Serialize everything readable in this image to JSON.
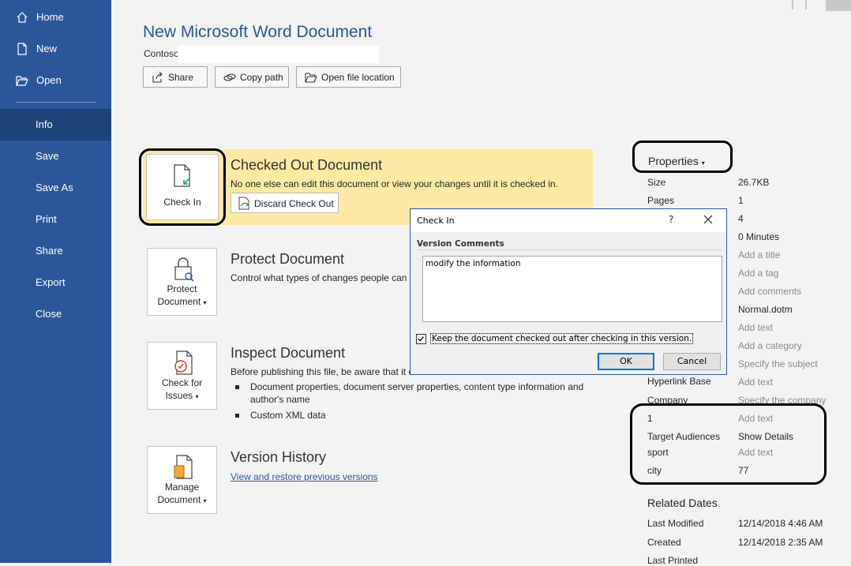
{
  "sidebar": {
    "items": [
      {
        "label": "Home",
        "icon": "home-icon"
      },
      {
        "label": "New",
        "icon": "new-doc-icon"
      },
      {
        "label": "Open",
        "icon": "folder-open-icon"
      },
      {
        "label": "Info"
      },
      {
        "label": "Save"
      },
      {
        "label": "Save As"
      },
      {
        "label": "Print"
      },
      {
        "label": "Share"
      },
      {
        "label": "Export"
      },
      {
        "label": "Close"
      }
    ],
    "active": "Info"
  },
  "header": {
    "title": "New Microsoft Word Document",
    "path": "Contoso",
    "buttons": {
      "share": "Share",
      "copy_path": "Copy path",
      "open_location": "Open file location"
    }
  },
  "sections": {
    "checkout": {
      "button_label": "Check In",
      "title": "Checked Out Document",
      "description": "No one else can edit this document or view your changes until it is checked in.",
      "discard_label": "Discard Check Out"
    },
    "protect": {
      "button_line1": "Protect",
      "button_line2": "Document",
      "title": "Protect Document",
      "description": "Control what types of changes people can m"
    },
    "inspect": {
      "button_line1": "Check for",
      "button_line2": "Issues",
      "title": "Inspect Document",
      "description": "Before publishing this file, be aware that it c",
      "bullets": [
        "Document properties, document server properties, content type information and author's name",
        "Custom XML data"
      ]
    },
    "version": {
      "button_line1": "Manage",
      "button_line2": "Document",
      "title": "Version History",
      "link": "View and restore previous versions"
    }
  },
  "properties": {
    "title": "Properties",
    "size_label": "Size",
    "size_value": "26.7KB",
    "pages_label": "Pages",
    "pages_value": "1",
    "words_value": "4",
    "time_value": "0 Minutes",
    "add_title": "Add a title",
    "add_tag": "Add a tag",
    "add_comments": "Add comments",
    "template_value": "Normal.dotm",
    "add_text_1": "Add text",
    "add_category": "Add a category",
    "specify_subject": "Specify the subject",
    "hyperlink_label": "Hyperlink Base",
    "hyperlink_value": "Add text",
    "company_label": "Company",
    "company_value": "Specify the company",
    "custom_1_label": "1",
    "custom_1_value": "Add text",
    "target_label": "Target Audiences",
    "target_value": "Show Details",
    "sport_label": "sport",
    "sport_value": "Add text",
    "city_label": "city",
    "city_value": "77"
  },
  "related_dates": {
    "title": "Related Dates",
    "last_modified_label": "Last Modified",
    "last_modified_value": "12/14/2018 4:46 AM",
    "created_label": "Created",
    "created_value": "12/14/2018 2:35 AM",
    "last_printed_label": "Last Printed"
  },
  "dialog": {
    "title": "Check In",
    "help": "?",
    "comments_label": "Version Comments",
    "comments_value": "modify the information",
    "keep_checked_label": "Keep the document checked out after checking in this version.",
    "keep_checked": true,
    "ok_label": "OK",
    "cancel_label": "Cancel"
  },
  "colors": {
    "accent": "#2b579a",
    "sidebar_active": "#1e4379",
    "checkout_bg": "#fbe9a4"
  }
}
